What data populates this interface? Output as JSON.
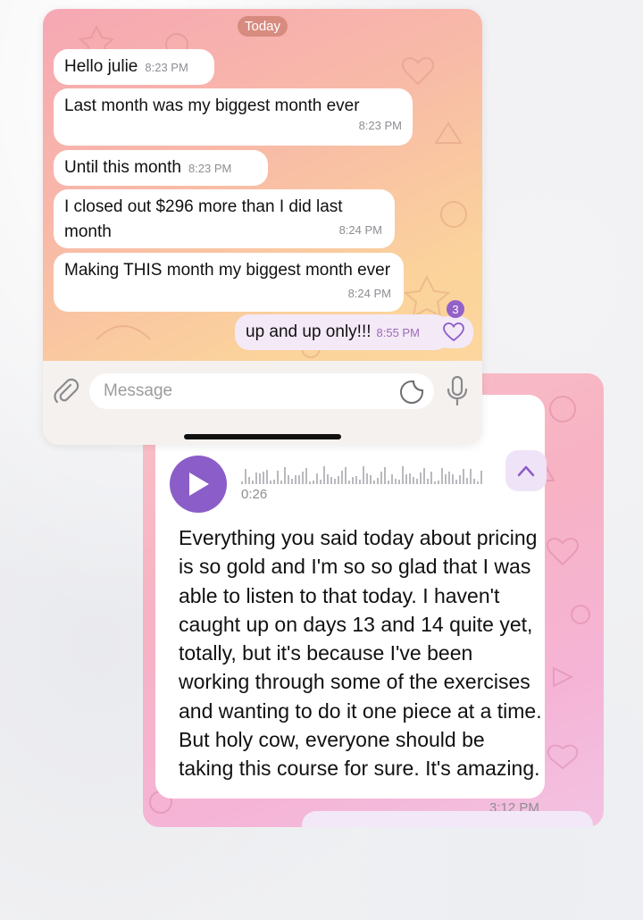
{
  "chat_top": {
    "date_chip": "Today",
    "messages": [
      {
        "text": "Hello julie",
        "time": "8:23 PM"
      },
      {
        "text": "Last month was my biggest month ever",
        "time": "8:23 PM"
      },
      {
        "text": "Until this month",
        "time": "8:23 PM"
      },
      {
        "text": "I closed out $296 more than I did last month",
        "time": "8:24 PM"
      },
      {
        "text": "Making THIS month my biggest month ever",
        "time": "8:24 PM"
      }
    ],
    "outgoing": {
      "text": "up and up only!!!",
      "time": "8:55 PM"
    },
    "reaction": {
      "icon": "heart-icon",
      "count": "3"
    },
    "input": {
      "placeholder": "Message"
    },
    "icons": {
      "attach": "paperclip-icon",
      "sticker": "sticker-icon",
      "mic": "microphone-icon"
    },
    "colors": {
      "accent": "#9461c8"
    }
  },
  "chat_bottom": {
    "voice": {
      "duration": "0:26",
      "transcript": "Everything you said today about pricing is so gold and I'm so so glad that I was able to listen to that today. I haven't caught up on days 13 and 14 quite yet, totally, but it's because I've been working through some of the exercises and wanting to do it one piece at a time. But holy cow, everyone should be taking this course for sure. It's amazing.",
      "time": "3:12 PM"
    },
    "icons": {
      "play": "play-icon",
      "collapse": "chevron-up-icon"
    },
    "colors": {
      "play_button": "#8b5dc8"
    }
  }
}
